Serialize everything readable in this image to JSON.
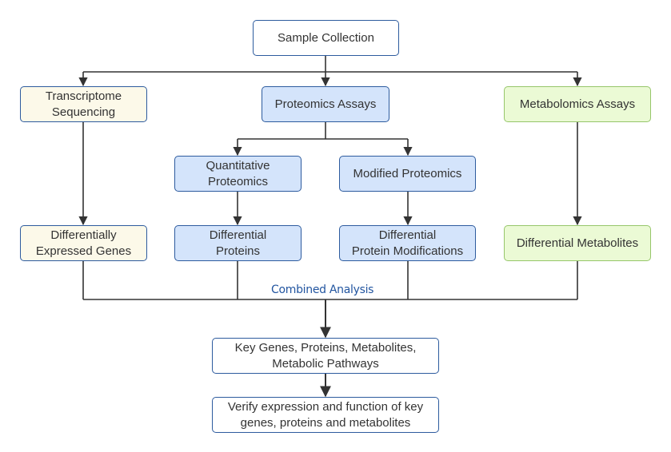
{
  "diagram": {
    "nodes": {
      "sample_collection": "Sample Collection",
      "transcriptome_sequencing": "Transcriptome\nSequencing",
      "proteomics_assays": "Proteomics Assays",
      "metabolomics_assays": "Metabolomics Assays",
      "quantitative_proteomics": "Quantitative\nProteomics",
      "modified_proteomics": "Modified Proteomics",
      "differentially_expressed_genes": "Differentially\nExpressed Genes",
      "differential_proteins": "Differential\nProteins",
      "differential_protein_modifications": "Differential\nProtein Modifications",
      "differential_metabolites": "Differential Metabolites",
      "key_items": "Key Genes, Proteins, Metabolites,\nMetabolic Pathways",
      "verify": "Verify expression and function of key\ngenes, proteins and metabolites"
    },
    "edge_labels": {
      "combined_analysis": "Combined Analysis"
    },
    "colors": {
      "blue_fill": "#d4e4fb",
      "cream_fill": "#fcf9e9",
      "green_fill": "#ebfad5",
      "border_blue": "#2d5b9e",
      "border_green": "#96c66a",
      "edge": "#333333",
      "label": "#2255a0"
    }
  }
}
